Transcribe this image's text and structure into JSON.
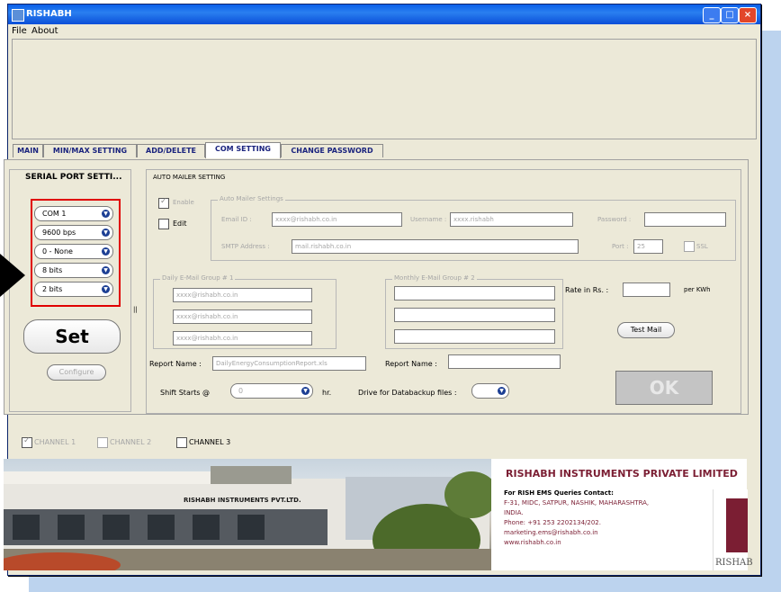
{
  "window": {
    "title": "RISHABH"
  },
  "menu": {
    "file": "File",
    "about": "About"
  },
  "tabs": [
    {
      "label": "MAIN"
    },
    {
      "label": "MIN/MAX SETTING"
    },
    {
      "label": "ADD/DELETE"
    },
    {
      "label": "COM SETTING"
    },
    {
      "label": "CHANGE PASSWORD"
    }
  ],
  "serial": {
    "title": "SERIAL PORT SETTI...",
    "com": "COM 1",
    "baud": "9600 bps",
    "parity": "0 - None",
    "databits": "8 bits",
    "stopbits": "2 bits",
    "set_label": "Set",
    "disabled_btn": "Configure"
  },
  "mailer": {
    "title": "AUTO MAILER SETTING",
    "enable_label": "Enable",
    "edit_label": "Edit",
    "mail_group_title": "Auto Mailer Settings",
    "email_id_label": "Email ID :",
    "email_id_value": "xxxx@rishabh.co.in",
    "username_label": "Username :",
    "username_value": "xxxx.rishabh",
    "password_label": "Password :",
    "password_value": "",
    "smtp_label": "SMTP Address :",
    "smtp_value": "mail.rishabh.co.in",
    "port_label": "Port :",
    "port_value": "25",
    "ssl_label": "SSL",
    "group1_title": "Daily E-Mail Group # 1",
    "group1_emails": [
      "xxxx@rishabh.co.in",
      "xxxx@rishabh.co.in",
      "xxxx@rishabh.co.in"
    ],
    "group2_title": "Monthly E-Mail Group # 2",
    "group2_emails": [
      "",
      "",
      ""
    ],
    "rate_label": "Rate in Rs. :",
    "rate_value": "",
    "rate_unit": "per KWh",
    "testmail_label": "Test Mail",
    "report1_label": "Report Name :",
    "report1_value": "DailyEnergyConsumptionReport.xls",
    "report2_label": "Report Name :",
    "report2_value": "",
    "shift_label": "Shift Starts @",
    "shift_value": "0",
    "shift_unit": "hr.",
    "drive_label": "Drive for Databackup files :",
    "drive_value": "",
    "ok_label": "OK"
  },
  "channels": [
    {
      "label": "CHANNEL 1"
    },
    {
      "label": "CHANNEL 2"
    },
    {
      "label": "CHANNEL 3"
    }
  ],
  "banner": {
    "building_sign": "RISHABH INSTRUMENTS PVT.LTD.",
    "company": "RISHABH INSTRUMENTS PRIVATE LIMITED",
    "contact_title": "For RISH EMS Queries Contact:",
    "address1": "F-31, MIDC, SATPUR, NASHIK, MAHARASHTRA,",
    "address2": "INDIA.",
    "phone": "Phone: +91 253 2202134/202.",
    "email": "marketing.ems@rishabh.co.in",
    "web": "www.rishabh.co.in",
    "logo_text": "RISHAB"
  },
  "colors": {
    "accent": "#1a237e",
    "brand": "#7b1e33",
    "highlight": "#e00000",
    "titlebar": "#0a5fe8"
  }
}
